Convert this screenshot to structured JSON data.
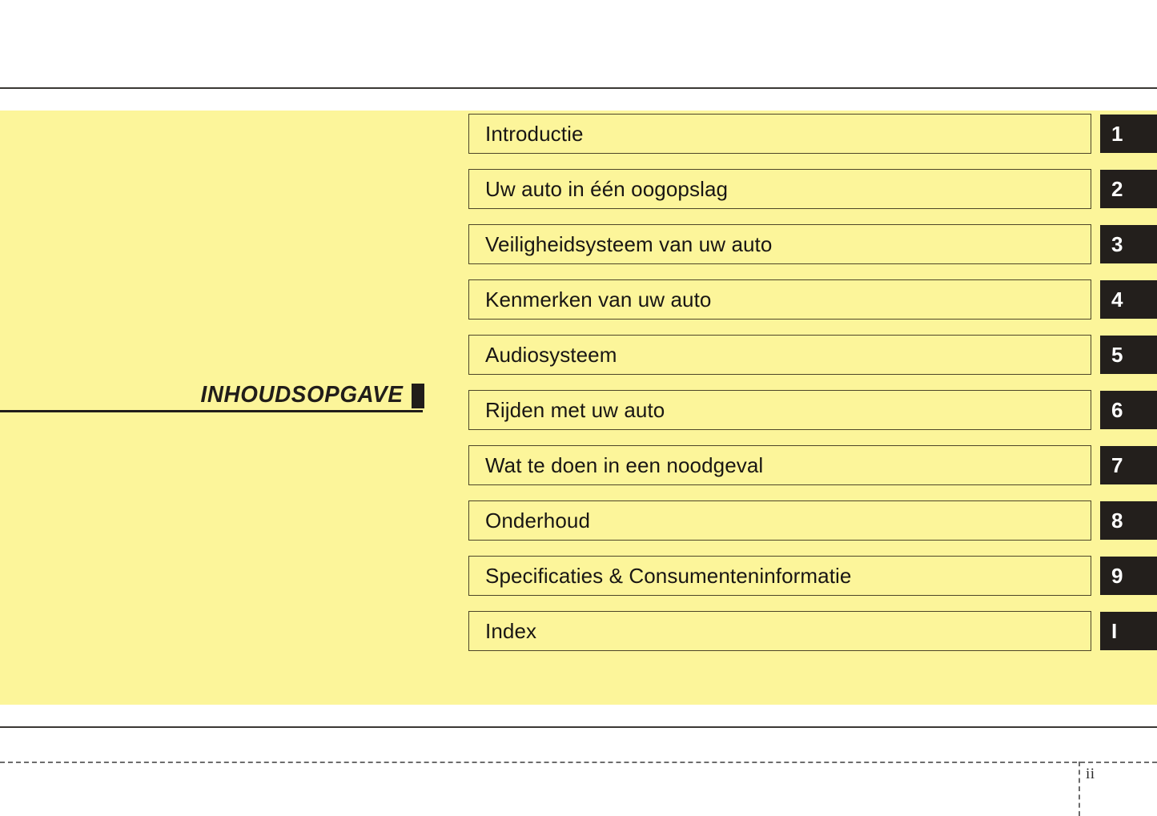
{
  "page": {
    "title": "INHOUDSOPGAVE",
    "title_marker": "black-square",
    "folio": "ii",
    "panel_color": "#fcf59a",
    "tab_color": "#231f1c",
    "rule_color": "#3a3734"
  },
  "contents": {
    "items": [
      {
        "label": "Introductie",
        "tab": "1"
      },
      {
        "label": "Uw auto in één oogopslag",
        "tab": "2"
      },
      {
        "label": "Veiligheidsysteem van uw auto",
        "tab": "3"
      },
      {
        "label": "Kenmerken van uw auto",
        "tab": "4"
      },
      {
        "label": "Audiosysteem",
        "tab": "5"
      },
      {
        "label": "Rijden met uw auto",
        "tab": "6"
      },
      {
        "label": "Wat te doen in een noodgeval",
        "tab": "7"
      },
      {
        "label": "Onderhoud",
        "tab": "8"
      },
      {
        "label": "Specificaties & Consumenteninformatie",
        "tab": "9"
      },
      {
        "label": "Index",
        "tab": "I"
      }
    ]
  }
}
